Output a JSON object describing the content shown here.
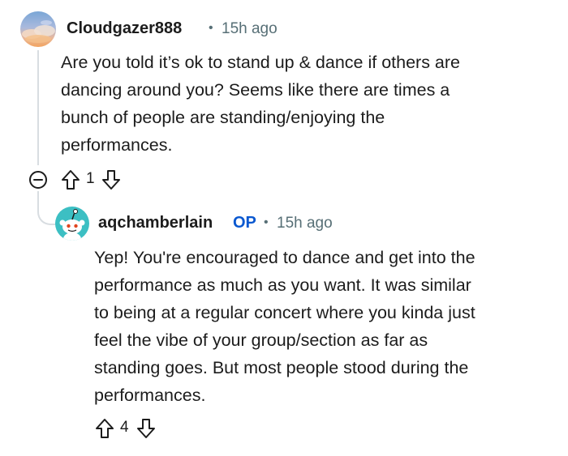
{
  "comments": [
    {
      "username": "Cloudgazer888",
      "separator": "•",
      "time": "15h ago",
      "body_lines": [
        "Are you told it’s ok to stand up & dance if others are",
        "dancing around you? Seems like there are times a",
        "bunch of people are standing/enjoying the",
        "performances."
      ],
      "votes": "1",
      "avatar": "cloud-sky-avatar-icon"
    },
    {
      "username": "aqchamberlain",
      "badge": "OP",
      "separator": "•",
      "time": "15h ago",
      "body_lines": [
        "Yep! You're encouraged to dance and get into the",
        "performance as much as you want. It was similar",
        "to being at a regular concert where you kinda just",
        "feel the vibe of your group/section as far as",
        "standing goes. But most people stood during the",
        "performances."
      ],
      "votes": "4",
      "avatar": "snoo-avatar-icon"
    }
  ],
  "icons": {
    "collapse": "minus-circle-icon",
    "upvote": "upvote-arrow-icon",
    "downvote": "downvote-arrow-icon"
  },
  "colors": {
    "op_badge": "#0a58d0",
    "meta_text": "#576f76",
    "thread_line": "#d8dde1",
    "snoo_avatar_bg": "#3cbfc3"
  }
}
